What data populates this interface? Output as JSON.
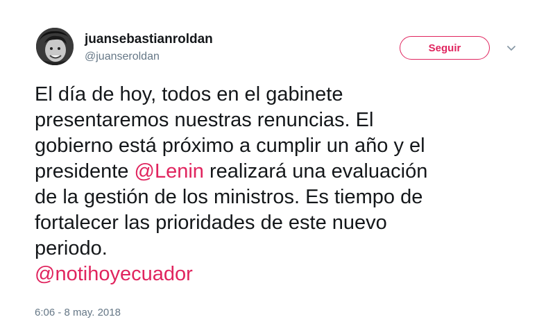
{
  "user": {
    "name": "juansebastianroldan",
    "handle": "@juanseroldan"
  },
  "follow_button": {
    "label": "Seguir"
  },
  "tweet": {
    "lines": [
      {
        "before": "El día de hoy, todos en el gabinete",
        "mention": "",
        "after": ""
      },
      {
        "before": "presentaremos nuestras renuncias. El",
        "mention": "",
        "after": ""
      },
      {
        "before": "gobierno está próximo a cumplir un año y el",
        "mention": "",
        "after": ""
      },
      {
        "before": "presidente ",
        "mention": "@Lenin",
        "after": " realizará una evaluación"
      },
      {
        "before": "de la gestión de los ministros. Es tiempo de",
        "mention": "",
        "after": ""
      },
      {
        "before": "fortalecer las prioridades de este nuevo",
        "mention": "",
        "after": ""
      },
      {
        "before": "periodo.",
        "mention": "",
        "after": ""
      },
      {
        "before": "",
        "mention": "@notihoyecuador",
        "after": ""
      }
    ],
    "timestamp": "6:06 - 8 may. 2018"
  },
  "icons": {
    "avatar": "user-photo",
    "menu": "chevron-down-icon"
  },
  "colors": {
    "accent": "#e0245e",
    "text": "#14171a",
    "muted": "#657786"
  }
}
